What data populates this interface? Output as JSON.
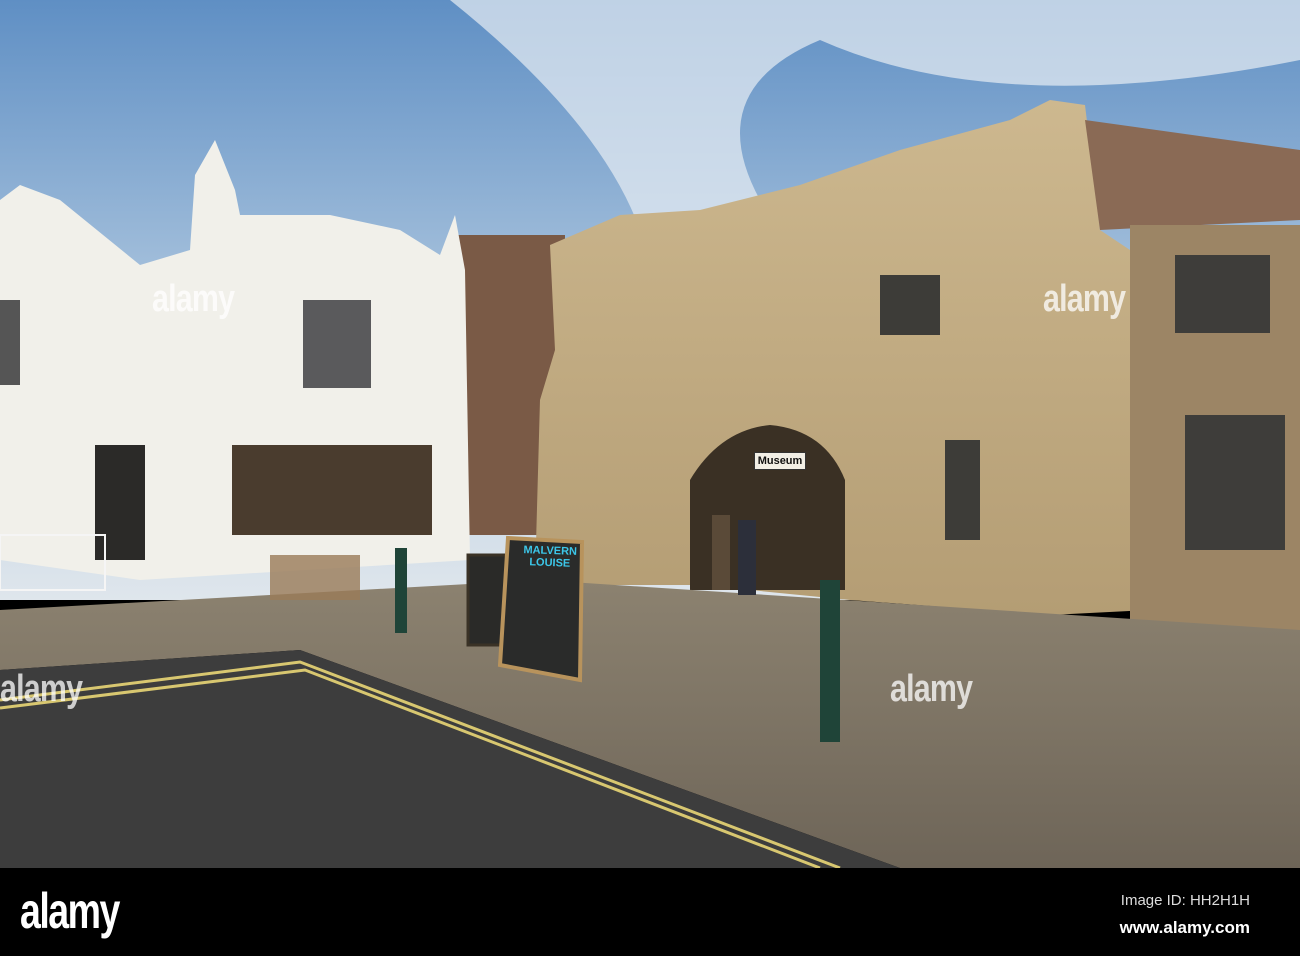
{
  "photo": {
    "museum_sign": "Museum",
    "chalkboard_title": "MALVERN LOUISE"
  },
  "watermark": {
    "text": "alamy"
  },
  "footer": {
    "logo": "alamy",
    "image_id": "Image ID: HH2H1H",
    "url": "www.alamy.com"
  }
}
